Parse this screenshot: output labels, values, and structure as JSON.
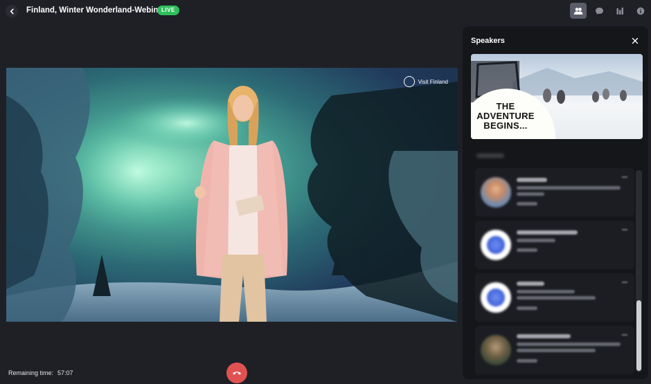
{
  "header": {
    "title": "Finland, Winter Wonderland-Webinar",
    "live_label": "LIVE",
    "icons": [
      "people-icon",
      "chat-icon",
      "poll-icon",
      "info-icon"
    ]
  },
  "stage": {
    "brand_label": "Visit Finland"
  },
  "footer": {
    "remaining_label": "Remaining time:",
    "remaining_value": "57:07"
  },
  "speakers_panel": {
    "title": "Speakers",
    "banner_text_line1": "THE",
    "banner_text_line2": "ADVENTURE",
    "banner_text_line3": "BEGINS..."
  },
  "colors": {
    "live": "#2fbf5b",
    "hangup": "#e05252",
    "background": "#1f2026",
    "panel": "#15161a"
  }
}
